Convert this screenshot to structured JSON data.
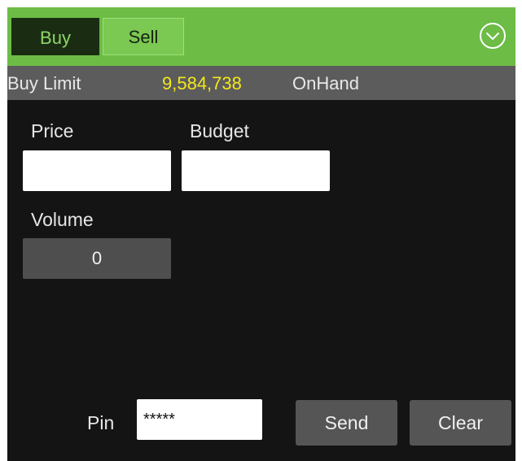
{
  "header": {
    "tab_buy": "Buy",
    "tab_sell": "Sell",
    "toggle_icon": "chevron-down-circle-icon"
  },
  "info": {
    "buy_limit_label": "Buy Limit",
    "buy_limit_value": "9,584,738",
    "onhand_label": "OnHand"
  },
  "form": {
    "price_label": "Price",
    "price_value": "",
    "budget_label": "Budget",
    "budget_value": "",
    "volume_label": "Volume",
    "volume_value": "0",
    "pin_label": "Pin",
    "pin_value": "*****"
  },
  "actions": {
    "send_label": "Send",
    "clear_label": "Clear"
  },
  "colors": {
    "header_green": "#6cbc45",
    "buy_limit_value": "#f5e81a",
    "panel_bg": "#141414"
  }
}
